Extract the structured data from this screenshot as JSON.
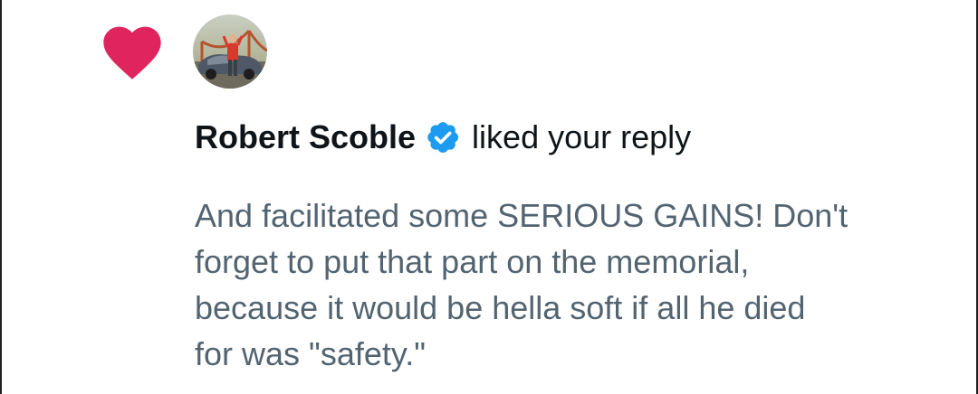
{
  "notification": {
    "icon": "heart-icon",
    "icon_color": "#f91880",
    "user": {
      "name": "Robert Scoble",
      "verified": true,
      "verified_badge_color": "#1d9bf0",
      "avatar": "user-avatar-photo"
    },
    "action_text": "liked your reply",
    "reply_text": "And facilitated some SERIOUS GAINS! Don't\nforget to put that part on the memorial,\nbecause it would be hella soft if all he died\nfor was \"safety.\""
  }
}
